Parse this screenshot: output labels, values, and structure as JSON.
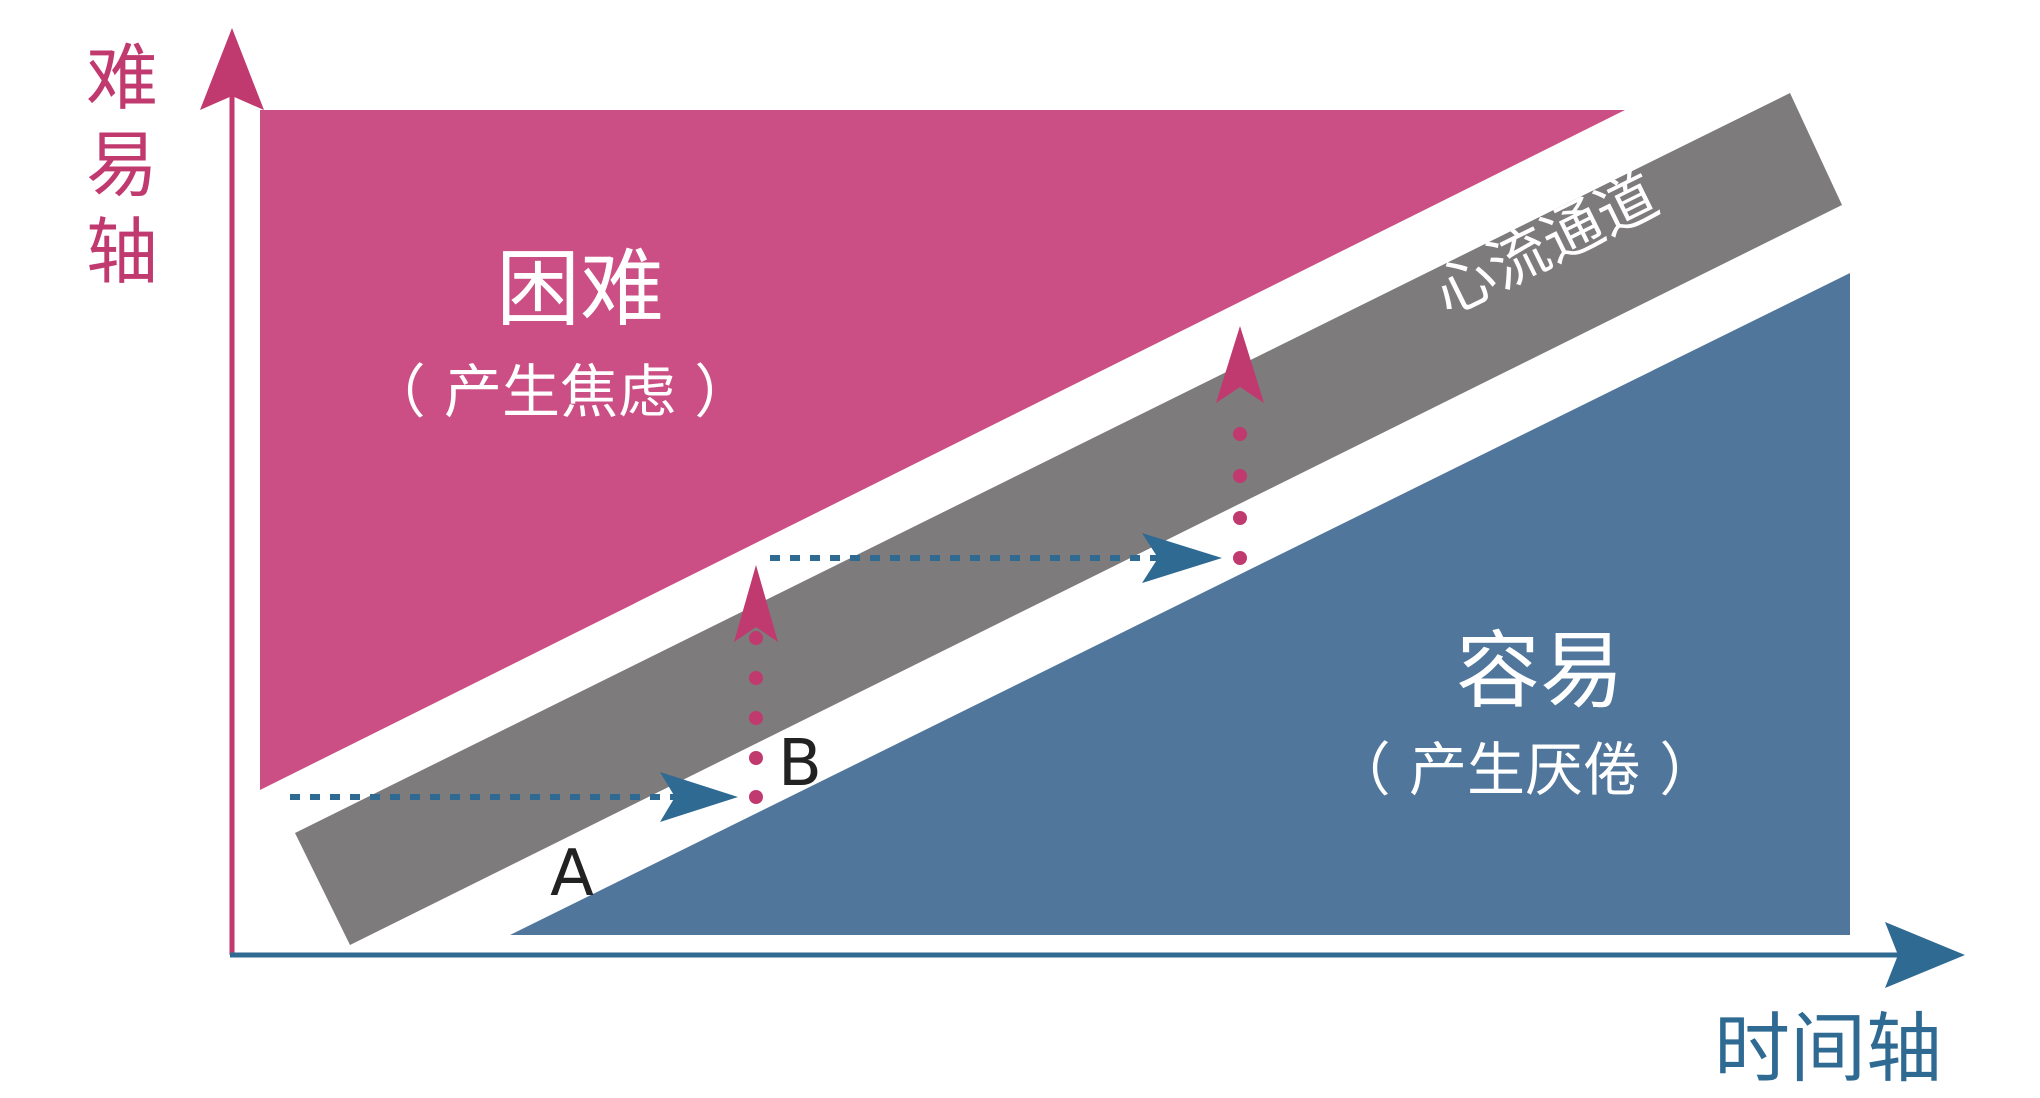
{
  "axes": {
    "y_label": "难易轴",
    "x_label": "时间轴"
  },
  "regions": {
    "hard": {
      "title": "困难",
      "subtitle": "（ 产生焦虑 ）"
    },
    "easy": {
      "title": "容易",
      "subtitle": "（ 产生厌倦 ）"
    },
    "flow": {
      "label": "心流通道"
    }
  },
  "points": {
    "a": "A",
    "b": "B"
  },
  "colors": {
    "hard_region": "#cb4f84",
    "easy_region": "#50769c",
    "flow_channel": "#7d7b7c",
    "y_axis": "#c0396f",
    "x_axis": "#2f6a93",
    "arrow_horizontal": "#2f6a93",
    "arrow_vertical": "#c0396f"
  }
}
